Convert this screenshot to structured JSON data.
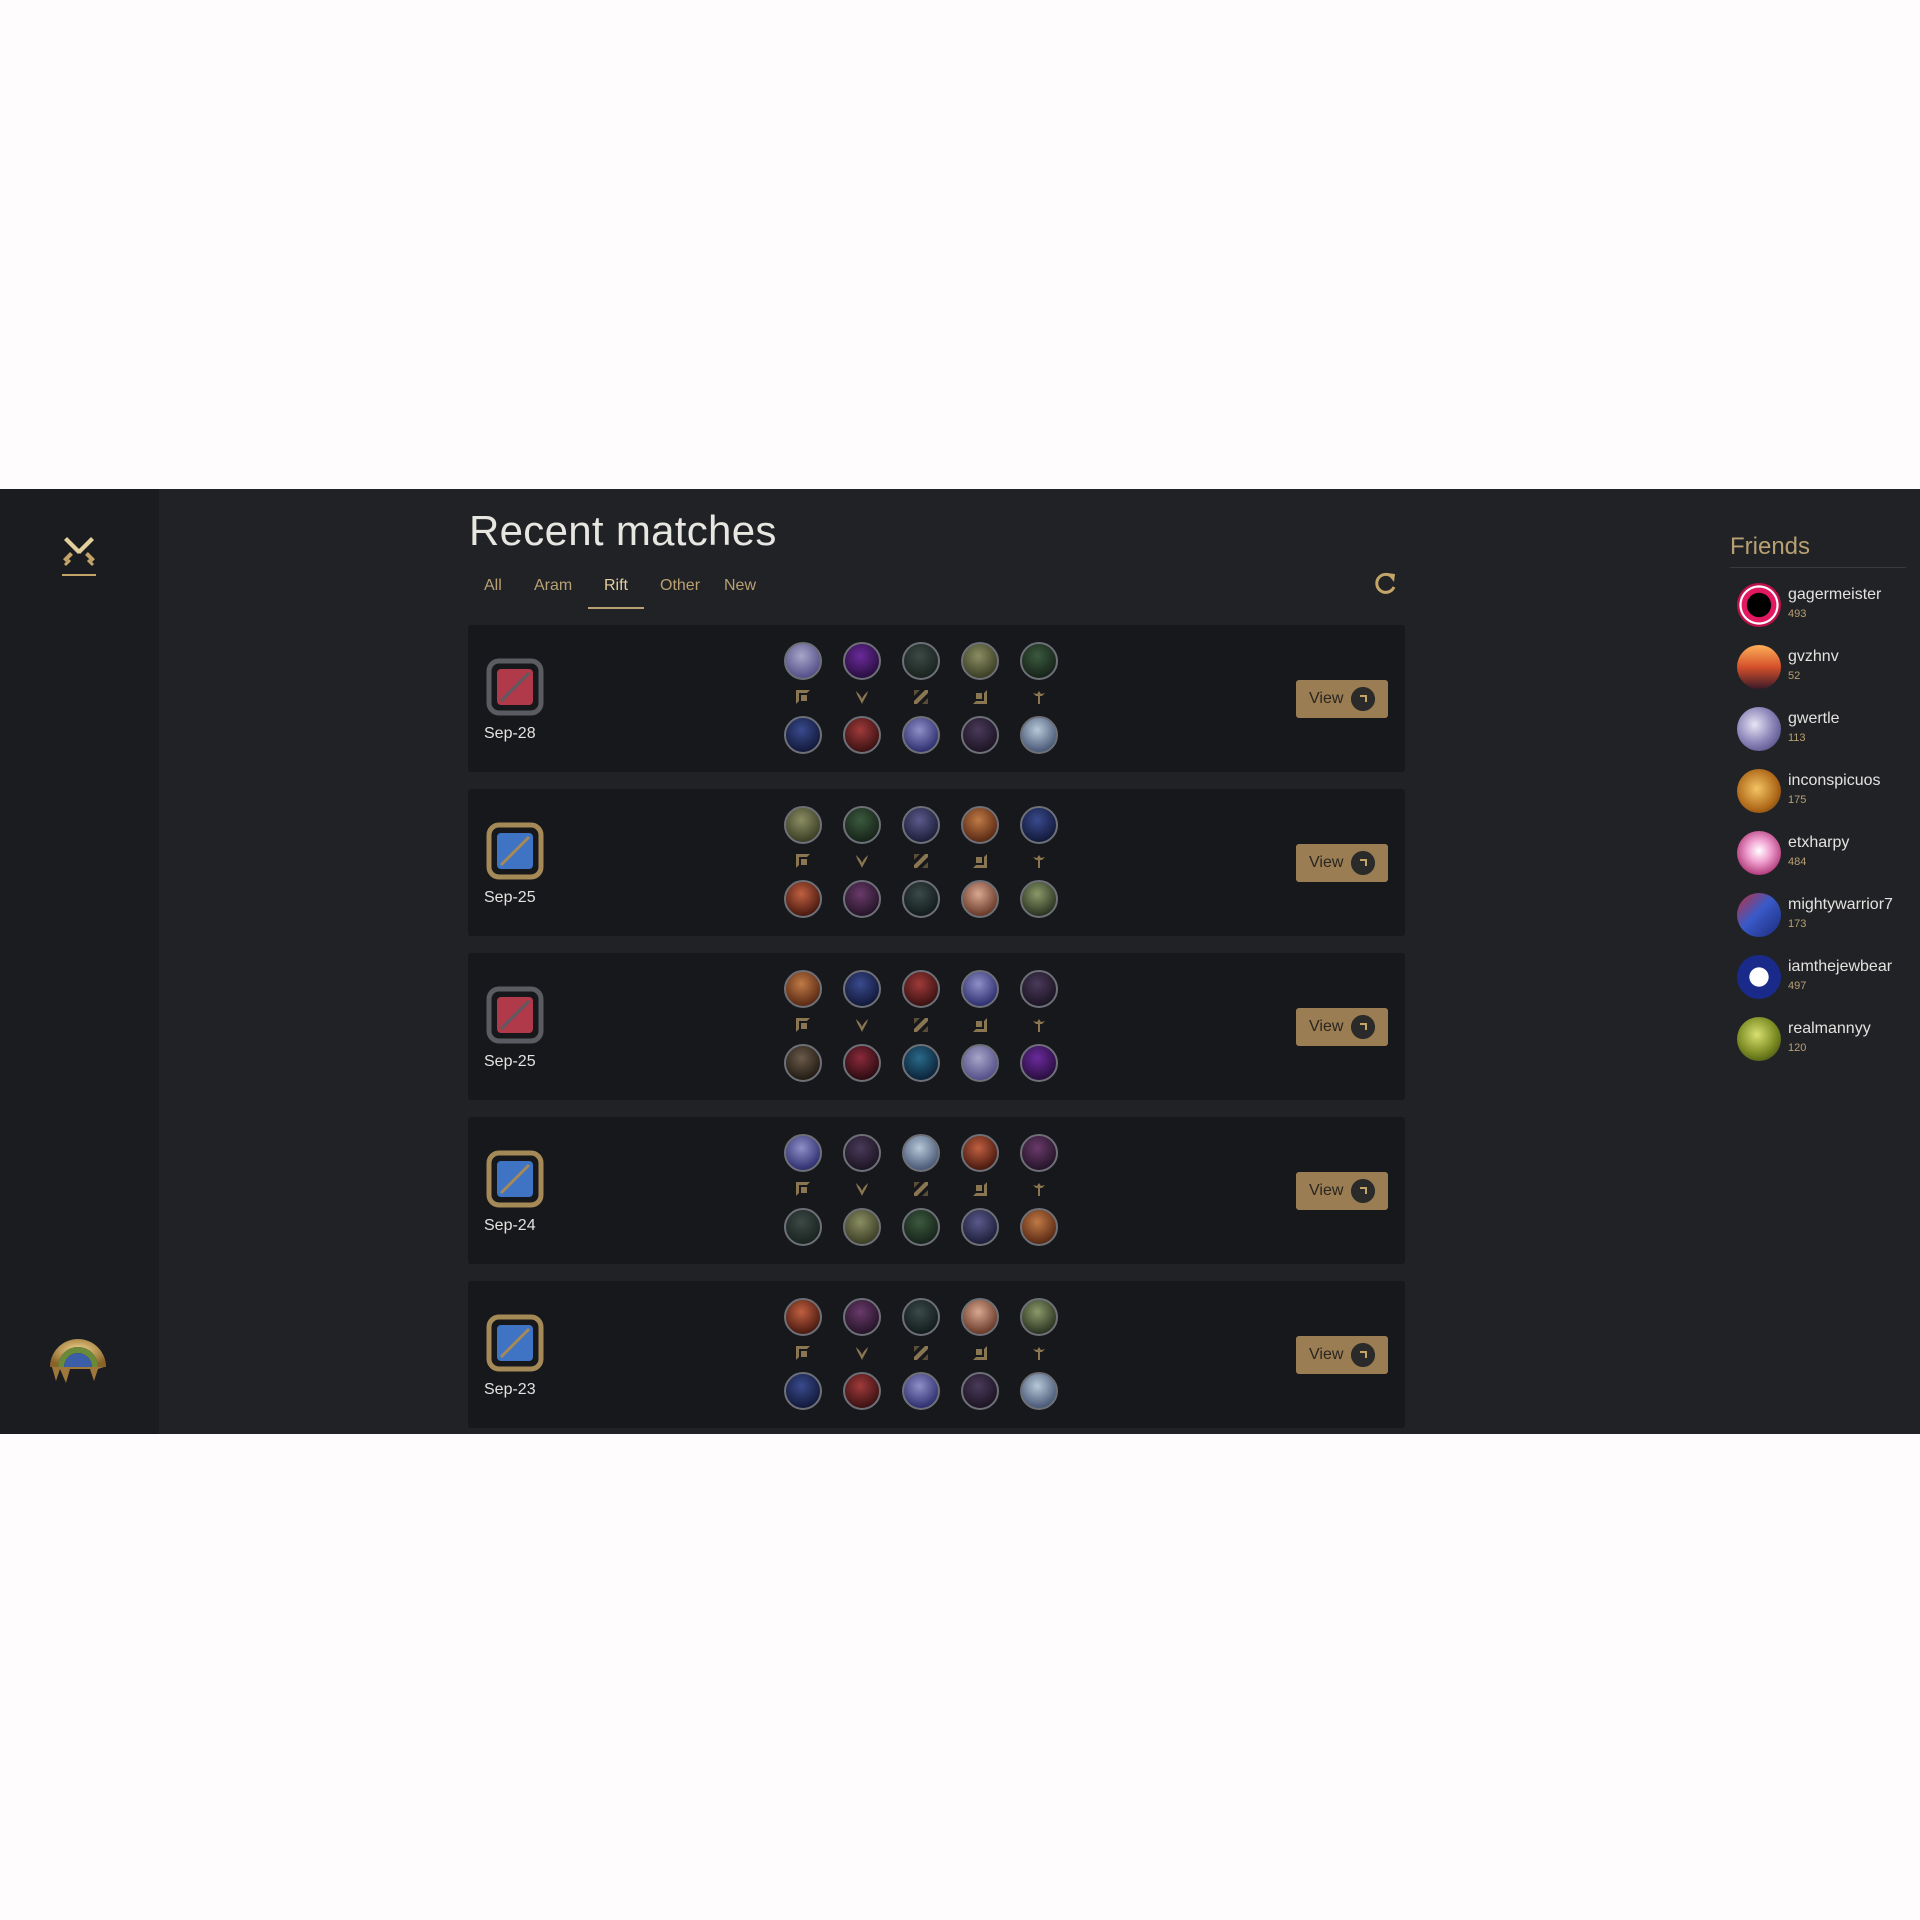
{
  "page": {
    "title": "Recent matches"
  },
  "tabs": [
    {
      "label": "All",
      "active": false
    },
    {
      "label": "Aram",
      "active": false
    },
    {
      "label": "Rift",
      "active": true
    },
    {
      "label": "Other",
      "active": false
    },
    {
      "label": "New",
      "active": false
    }
  ],
  "view_label": "View",
  "colors": {
    "accent": "#b8a073",
    "loss": "#b0394a",
    "win": "#3f74c4",
    "button": "#9a7d52"
  },
  "icons": {
    "logo": "crossed-swords-icon",
    "refresh": "refresh-icon",
    "view": "arrow-corner-icon"
  },
  "roles": [
    "top",
    "jungle",
    "mid",
    "bottom",
    "support"
  ],
  "matches": [
    {
      "result": "loss",
      "date": "Sep-28"
    },
    {
      "result": "win",
      "date": "Sep-25"
    },
    {
      "result": "loss",
      "date": "Sep-25"
    },
    {
      "result": "win",
      "date": "Sep-24"
    },
    {
      "result": "win",
      "date": "Sep-23"
    }
  ],
  "friends": {
    "title": "Friends",
    "list": [
      {
        "name": "gagermeister",
        "level": "493"
      },
      {
        "name": "gvzhnv",
        "level": "52"
      },
      {
        "name": "gwertle",
        "level": "113"
      },
      {
        "name": "inconspicuos",
        "level": "175"
      },
      {
        "name": "etxharpy",
        "level": "484"
      },
      {
        "name": "mightywarrior7",
        "level": "173"
      },
      {
        "name": "iamthejewbear",
        "level": "497"
      },
      {
        "name": "realmannyy",
        "level": "120"
      }
    ]
  }
}
